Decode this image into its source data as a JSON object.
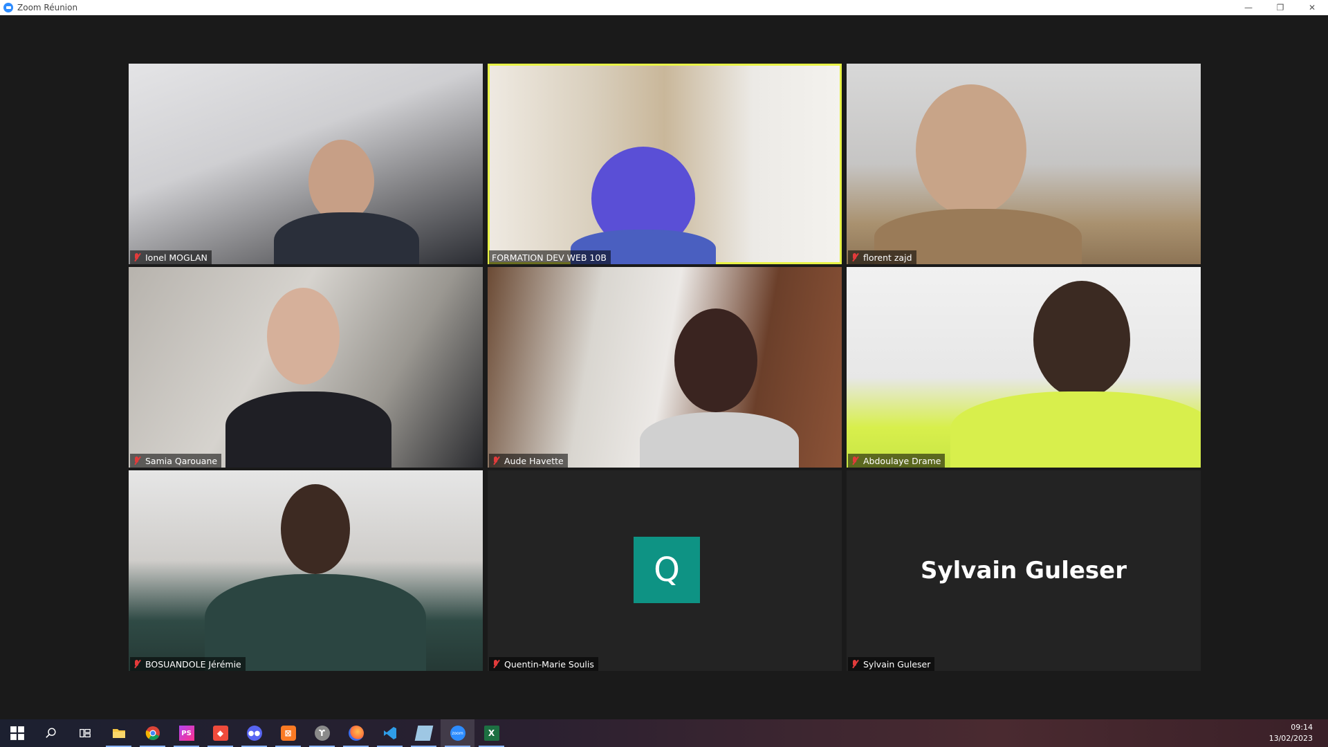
{
  "window": {
    "title": "Zoom Réunion",
    "controls": {
      "minimize": "—",
      "restore": "❐",
      "close": "✕"
    }
  },
  "participants": [
    {
      "name": "Ionel MOGLAN",
      "muted": true,
      "video": true
    },
    {
      "name": "FORMATION DEV WEB 10B",
      "muted": false,
      "video": true,
      "active_speaker": true
    },
    {
      "name": "florent zajd",
      "muted": true,
      "video": true
    },
    {
      "name": "Samia Qarouane",
      "muted": true,
      "video": true
    },
    {
      "name": "Aude Havette",
      "muted": true,
      "video": true
    },
    {
      "name": "Abdoulaye Drame",
      "muted": true,
      "video": true
    },
    {
      "name": "BOSUANDOLE Jérémie",
      "muted": true,
      "video": true
    },
    {
      "name": "Quentin-Marie Soulis",
      "muted": true,
      "video": false,
      "avatar_letter": "Q",
      "avatar_color": "#0e9384"
    },
    {
      "name": "Sylvain Guleser",
      "muted": true,
      "video": false,
      "display_name": "Sylvain Guleser"
    }
  ],
  "colors": {
    "active_speaker_border": "#e8f246",
    "muted_icon": "#e23b3b",
    "background": "#1a1a1a"
  },
  "taskbar": {
    "items": [
      {
        "name": "start",
        "icon": "windows-icon"
      },
      {
        "name": "search",
        "icon": "search-icon"
      },
      {
        "name": "task-view",
        "icon": "task-view-icon"
      },
      {
        "name": "file-explorer",
        "icon": "folder-icon"
      },
      {
        "name": "chrome",
        "icon": "chrome-icon"
      },
      {
        "name": "phpstorm",
        "icon": "phpstorm-icon",
        "label": "PS"
      },
      {
        "name": "app-red",
        "icon": "red-app-icon"
      },
      {
        "name": "discord",
        "icon": "discord-icon"
      },
      {
        "name": "xampp",
        "icon": "xampp-icon"
      },
      {
        "name": "pgadmin",
        "icon": "elephant-icon"
      },
      {
        "name": "firefox",
        "icon": "firefox-icon"
      },
      {
        "name": "vscode",
        "icon": "vscode-icon"
      },
      {
        "name": "notes",
        "icon": "notes-icon"
      },
      {
        "name": "zoom",
        "icon": "zoom-icon",
        "label": "zoom"
      },
      {
        "name": "excel",
        "icon": "excel-icon",
        "label": "X"
      }
    ],
    "clock": {
      "time": "09:14",
      "date": "13/02/2023"
    }
  }
}
